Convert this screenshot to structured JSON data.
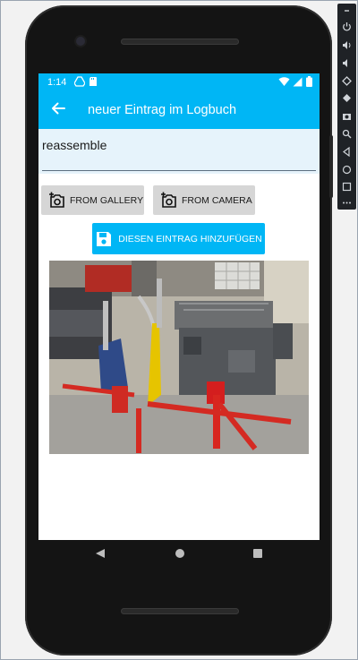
{
  "status_bar": {
    "time": "1:14"
  },
  "app_bar": {
    "title": "neuer Eintrag im Logbuch"
  },
  "entry_input": {
    "value": "reassemble"
  },
  "buttons": {
    "from_gallery": "FROM GALLERY",
    "from_camera": "FROM CAMERA",
    "add_entry": "DIESEN EINTRAG HINZUFÜGEN"
  },
  "photo": {
    "description_tag": "engine-on-stand-photo"
  },
  "colors": {
    "accent": "#00b6f5",
    "button_gray": "#d6d6d6",
    "input_bg": "#e6f3fb"
  }
}
